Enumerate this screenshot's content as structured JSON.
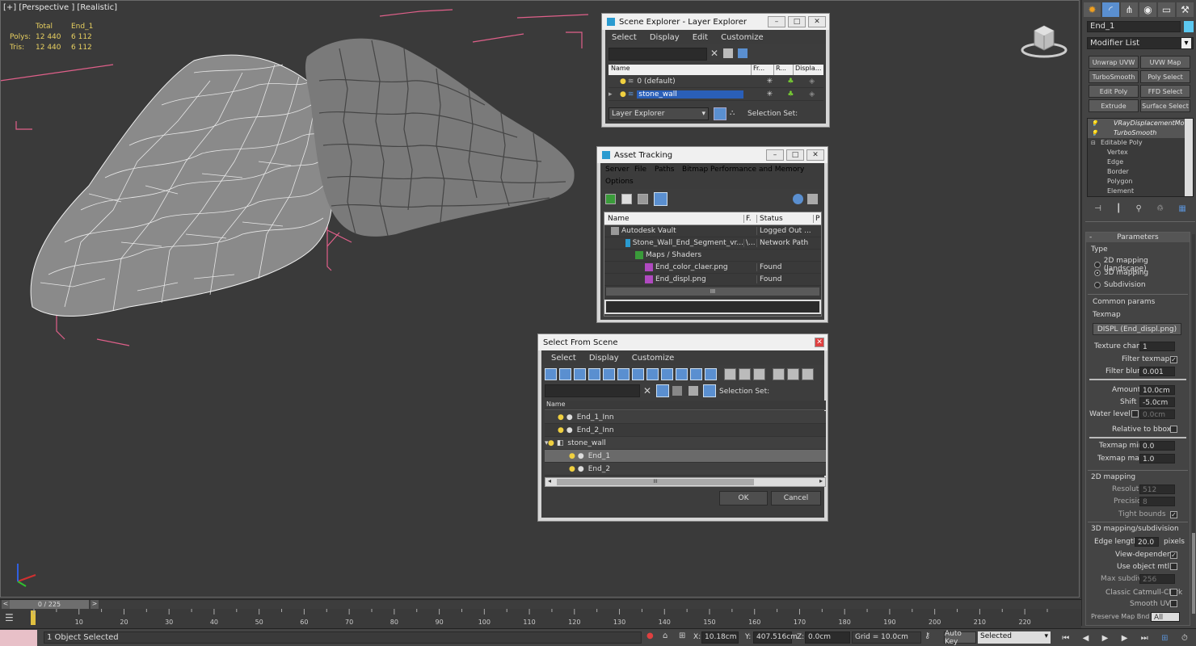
{
  "viewport": {
    "label": "[+] [Perspective ] [Realistic]",
    "stats": {
      "col_total": "Total",
      "col_obj": "End_1",
      "polys_label": "Polys:",
      "polys_total": "12 440",
      "polys_obj": "6 112",
      "tris_label": "Tris:",
      "tris_total": "12 440",
      "tris_obj": "6 112"
    }
  },
  "scene_explorer": {
    "title": "Scene Explorer - Layer Explorer",
    "menu": [
      "Select",
      "Display",
      "Edit",
      "Customize"
    ],
    "columns": [
      "Name",
      "Fr...",
      "R...",
      "Displa..."
    ],
    "rows": [
      "0 (default)",
      "stone_wall"
    ],
    "footer_dropdown": "Layer Explorer",
    "footer_selection": "Selection Set:"
  },
  "asset_tracking": {
    "title": "Asset Tracking",
    "menu": [
      "Server",
      "File",
      "Paths",
      "Bitmap Performance and Memory",
      "Options"
    ],
    "columns": [
      "Name",
      "F.",
      "Status",
      "P"
    ],
    "rows": [
      {
        "name": "Autodesk Vault",
        "f": "",
        "status": "Logged Out ..."
      },
      {
        "name": "Stone_Wall_End_Segment_vr...",
        "f": "\\...",
        "status": "Network Path"
      },
      {
        "name": "Maps / Shaders",
        "f": "",
        "status": ""
      },
      {
        "name": "End_color_claer.png",
        "f": "",
        "status": "Found"
      },
      {
        "name": "End_displ.png",
        "f": "",
        "status": "Found"
      }
    ],
    "scroll_grip": "III"
  },
  "select_from_scene": {
    "title": "Select From Scene",
    "menu": [
      "Select",
      "Display",
      "Customize"
    ],
    "selection_set": "Selection Set:",
    "column": "Name",
    "rows": [
      "End_1_Inn",
      "End_2_Inn",
      "stone_wall",
      "End_1",
      "End_2"
    ],
    "ok": "OK",
    "cancel": "Cancel",
    "scroll_grip": "III"
  },
  "command_panel": {
    "object_name": "End_1",
    "modifier_list": "Modifier List",
    "mod_buttons": [
      "Unwrap UVW",
      "UVW Map",
      "TurboSmooth",
      "Poly Select",
      "Edit Poly",
      "FFD Select",
      "Extrude",
      "Surface Select"
    ],
    "stack": [
      "VRayDisplacementMo",
      "TurboSmooth",
      "Editable Poly",
      "Vertex",
      "Edge",
      "Border",
      "Polygon",
      "Element"
    ],
    "parameters": "Parameters",
    "type_label": "Type",
    "type_options": [
      "2D mapping (landscape)",
      "3D mapping",
      "Subdivision"
    ],
    "common_params": "Common params",
    "texmap_label": "Texmap",
    "texmap_value": "DISPL (End_displ.png)",
    "texture_chan_label": "Texture chan",
    "texture_chan_value": "1",
    "filter_texmap": "Filter texmap",
    "filter_blur_label": "Filter blur",
    "filter_blur_value": "0.001",
    "amount_label": "Amount",
    "amount_value": "10.0cm",
    "shift_label": "Shift",
    "shift_value": "-5.0cm",
    "water_level_label": "Water level",
    "water_level_value": "0.0cm",
    "relative_to_bbox": "Relative to bbox",
    "texmap_min_label": "Texmap min",
    "texmap_min_value": "0.0",
    "texmap_max_label": "Texmap max",
    "texmap_max_value": "1.0",
    "mapping2d": "2D mapping",
    "resolution_label": "Resolution",
    "resolution_value": "512",
    "precision_label": "Precision",
    "precision_value": "8",
    "tight_bounds": "Tight bounds",
    "mapping3d": "3D mapping/subdivision",
    "edge_length_label": "Edge length",
    "edge_length_value": "20.0",
    "pixels": "pixels",
    "view_dependent": "View-dependent",
    "use_object_mtl": "Use object mtl",
    "max_subdivs_label": "Max subdivs",
    "max_subdivs_value": "256",
    "classic_catmull": "Classic Catmull-Clark",
    "smooth_uvs": "Smooth UVs",
    "preserve_map_bnd": "Preserve Map Bnd",
    "preserve_value": "All"
  },
  "timeline": {
    "frame": "0 / 225",
    "ticks": [
      "10",
      "20",
      "30",
      "40",
      "50",
      "60",
      "70",
      "80",
      "90",
      "100",
      "110",
      "120",
      "130",
      "140",
      "150",
      "160",
      "170",
      "180",
      "190",
      "200",
      "210",
      "220"
    ]
  },
  "statusbar": {
    "status": "1 Object Selected",
    "x_label": "X:",
    "x_value": "10.18cm",
    "y_label": "Y:",
    "y_value": "407.516cm",
    "z_label": "Z:",
    "z_value": "0.0cm",
    "grid": "Grid = 10.0cm",
    "auto_key": "Auto Key",
    "selected": "Selected"
  }
}
